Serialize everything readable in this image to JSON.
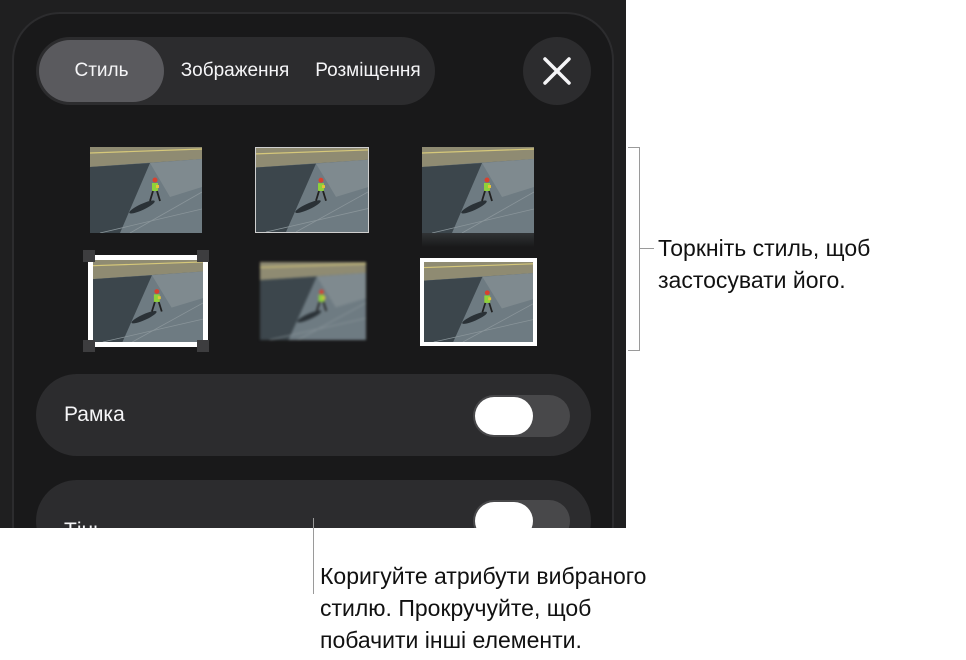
{
  "segments": {
    "style": "Стиль",
    "image": "Зображення",
    "arrange": "Розміщення"
  },
  "close_icon": "close-icon",
  "style_thumbnails": [
    {
      "style": "plain"
    },
    {
      "style": "thin-border"
    },
    {
      "style": "reflection"
    },
    {
      "style": "photo-corners"
    },
    {
      "style": "blurred-edges"
    },
    {
      "style": "white-frame"
    }
  ],
  "options": {
    "border": {
      "label": "Рамка",
      "on": false
    },
    "shadow": {
      "label": "Тінь",
      "on": false
    }
  },
  "callouts": {
    "styles": [
      "Торкніть стиль, щоб",
      "застосувати його."
    ],
    "attributes": [
      "Коригуйте атрибути вибраного",
      "стилю. Прокручуйте, щоб",
      "побачити інші елементи."
    ]
  },
  "colors": {
    "panel": "#19191a",
    "control": "#2c2c2e",
    "segment_active": "#5a5a5e",
    "text": "#f5f5f7"
  }
}
